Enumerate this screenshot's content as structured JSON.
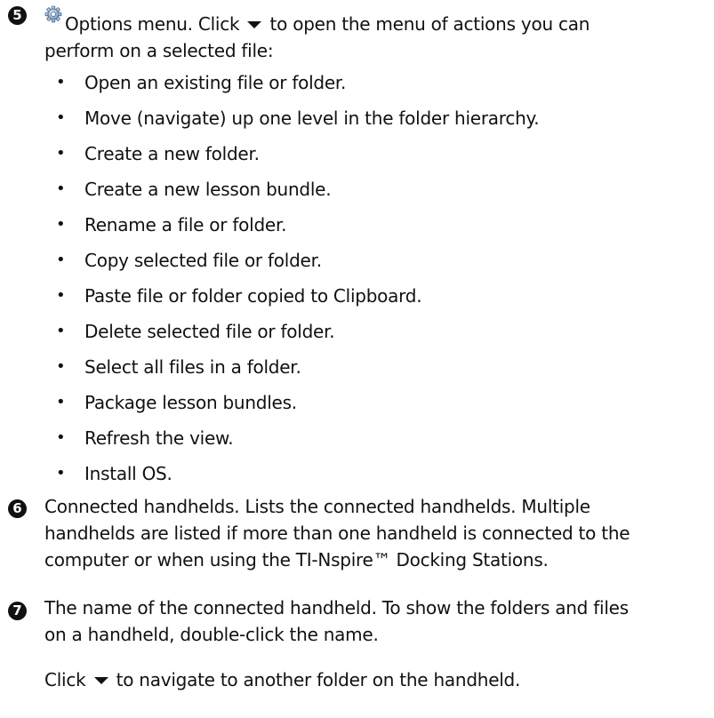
{
  "section5": {
    "marker": "5",
    "line1_text": "Options menu. Click",
    "line1_tail": "to open the menu of actions you can",
    "line2": "perform on a selected file:",
    "gear_icon": "gear-icon",
    "caret_icon": "caret-down-icon",
    "bullet_char": "•",
    "items": [
      "Open an existing file or folder.",
      "Move (navigate) up one level in the folder hierarchy.",
      "Create a new folder.",
      "Create a new lesson bundle.",
      "Rename a file or folder.",
      "Copy selected file or folder.",
      "Paste file or folder copied to Clipboard.",
      "Delete selected file or folder.",
      "Select all files in a folder.",
      "Package lesson bundles.",
      "Refresh the view.",
      "Install OS."
    ]
  },
  "section6": {
    "marker": "6",
    "lines": [
      "Connected handhelds. Lists the connected handhelds. Multiple",
      "handhelds are listed if more than one handheld is connected to the",
      "computer or when using the TI-Nspire™ Docking Stations."
    ]
  },
  "section7": {
    "marker": "7",
    "lines": [
      "The name of the connected handheld. To show the folders and files",
      "on a handheld, double-click the name."
    ],
    "click_prefix": "Click",
    "click_suffix": "to navigate to another folder on the handheld.",
    "caret_icon": "caret-down-icon"
  }
}
